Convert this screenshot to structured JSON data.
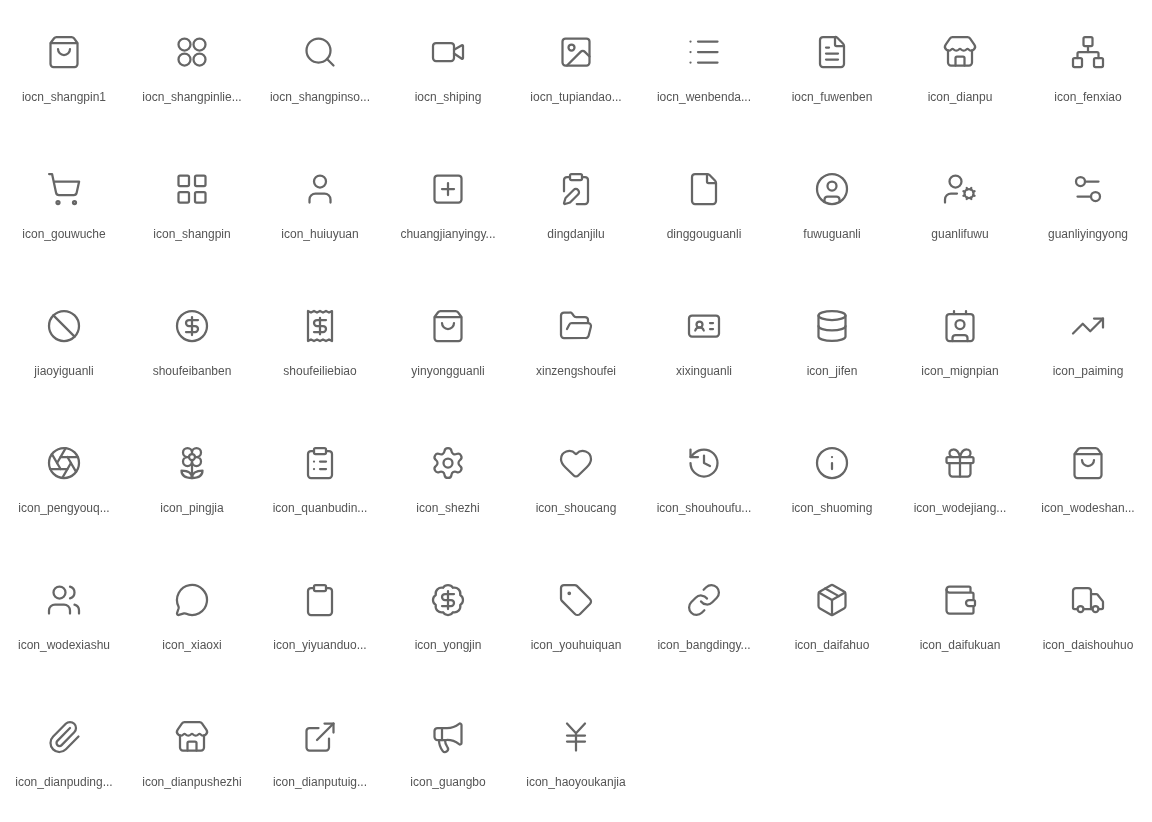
{
  "icons": [
    {
      "kind": "bag",
      "label": "iocn_shangpin1"
    },
    {
      "kind": "circles",
      "label": "iocn_shangpinlie..."
    },
    {
      "kind": "search",
      "label": "iocn_shangpinso..."
    },
    {
      "kind": "video",
      "label": "iocn_shiping"
    },
    {
      "kind": "image",
      "label": "iocn_tupiandao..."
    },
    {
      "kind": "list",
      "label": "iocn_wenbenda..."
    },
    {
      "kind": "doc",
      "label": "iocn_fuwenben"
    },
    {
      "kind": "store",
      "label": "icon_dianpu"
    },
    {
      "kind": "network",
      "label": "icon_fenxiao"
    },
    {
      "kind": "cart",
      "label": "icon_gouwuche"
    },
    {
      "kind": "grid",
      "label": "icon_shangpin"
    },
    {
      "kind": "user",
      "label": "icon_huiuyuan"
    },
    {
      "kind": "squareplus",
      "label": "chuangjianyingy..."
    },
    {
      "kind": "clipboardpen",
      "label": "dingdanjilu"
    },
    {
      "kind": "file",
      "label": "dinggouguanli"
    },
    {
      "kind": "usercircle",
      "label": "fuwuguanli"
    },
    {
      "kind": "usercog",
      "label": "guanlifuwu"
    },
    {
      "kind": "sliders",
      "label": "guanliyingyong"
    },
    {
      "kind": "ban",
      "label": "jiaoyiguanli"
    },
    {
      "kind": "dollarcircle",
      "label": "shoufeibanben"
    },
    {
      "kind": "receipt",
      "label": "shoufeiliebiao"
    },
    {
      "kind": "bag",
      "label": "yinyongguanli"
    },
    {
      "kind": "folder",
      "label": "xinzengshoufei"
    },
    {
      "kind": "idcard",
      "label": "xixinguanli"
    },
    {
      "kind": "database",
      "label": "icon_jifen"
    },
    {
      "kind": "contact",
      "label": "icon_mignpian"
    },
    {
      "kind": "trend",
      "label": "icon_paiming"
    },
    {
      "kind": "aperture",
      "label": "icon_pengyouq..."
    },
    {
      "kind": "flower",
      "label": "icon_pingjia"
    },
    {
      "kind": "clipboardlist",
      "label": "icon_quanbudin..."
    },
    {
      "kind": "settings",
      "label": "icon_shezhi"
    },
    {
      "kind": "heart",
      "label": "icon_shoucang"
    },
    {
      "kind": "history",
      "label": "icon_shouhoufu..."
    },
    {
      "kind": "info",
      "label": "icon_shuoming"
    },
    {
      "kind": "gift",
      "label": "icon_wodejiang..."
    },
    {
      "kind": "bag",
      "label": "icon_wodeshan..."
    },
    {
      "kind": "users",
      "label": "icon_wodexiashu"
    },
    {
      "kind": "message",
      "label": "icon_xiaoxi"
    },
    {
      "kind": "clipboard",
      "label": "icon_yiyuanduo..."
    },
    {
      "kind": "badgedollar",
      "label": "icon_yongjin"
    },
    {
      "kind": "tag",
      "label": "icon_youhuiquan"
    },
    {
      "kind": "link",
      "label": "icon_bangdingy..."
    },
    {
      "kind": "package",
      "label": "icon_daifahuo"
    },
    {
      "kind": "wallet",
      "label": "icon_daifukuan"
    },
    {
      "kind": "truck",
      "label": "icon_daishouhuo"
    },
    {
      "kind": "paperclip",
      "label": "icon_dianpuding..."
    },
    {
      "kind": "store",
      "label": "icon_dianpushezhi"
    },
    {
      "kind": "external",
      "label": "icon_dianputuig..."
    },
    {
      "kind": "megaphone",
      "label": "icon_guangbo"
    },
    {
      "kind": "yen",
      "label": "icon_haoyoukanjia"
    }
  ]
}
